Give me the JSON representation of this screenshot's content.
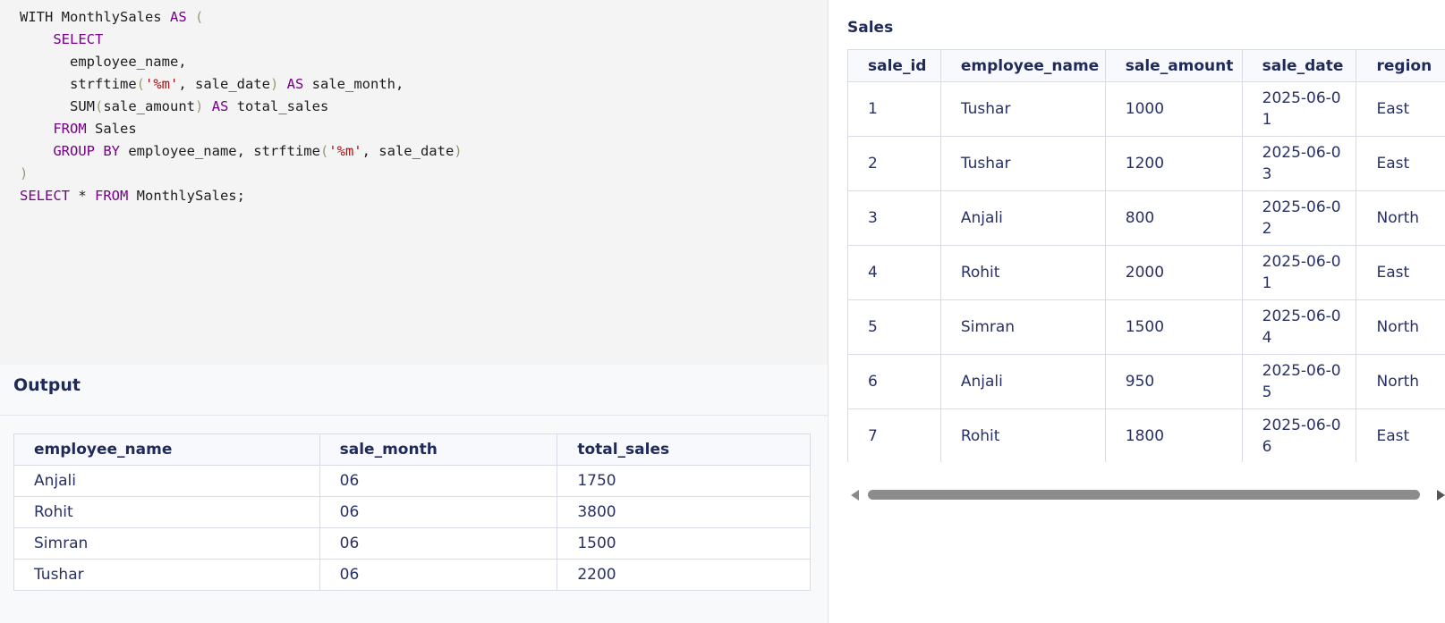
{
  "editor": {
    "lines": [
      [
        {
          "t": "WITH MonthlySales ",
          "c": ""
        },
        {
          "t": "AS",
          "c": "kw"
        },
        {
          "t": " ",
          "c": ""
        },
        {
          "t": "(",
          "c": "pn"
        }
      ],
      [
        {
          "t": "    ",
          "c": ""
        },
        {
          "t": "SELECT",
          "c": "kw"
        }
      ],
      [
        {
          "t": "      employee_name,",
          "c": ""
        }
      ],
      [
        {
          "t": "      strftime",
          "c": ""
        },
        {
          "t": "(",
          "c": "pn"
        },
        {
          "t": "'%m'",
          "c": "str"
        },
        {
          "t": ", sale_date",
          "c": ""
        },
        {
          "t": ")",
          "c": "pn"
        },
        {
          "t": " ",
          "c": ""
        },
        {
          "t": "AS",
          "c": "kw"
        },
        {
          "t": " sale_month,",
          "c": ""
        }
      ],
      [
        {
          "t": "      SUM",
          "c": ""
        },
        {
          "t": "(",
          "c": "pn"
        },
        {
          "t": "sale_amount",
          "c": ""
        },
        {
          "t": ")",
          "c": "pn"
        },
        {
          "t": " ",
          "c": ""
        },
        {
          "t": "AS",
          "c": "kw"
        },
        {
          "t": " total_sales",
          "c": ""
        }
      ],
      [
        {
          "t": "    ",
          "c": ""
        },
        {
          "t": "FROM",
          "c": "kw"
        },
        {
          "t": " Sales",
          "c": ""
        }
      ],
      [
        {
          "t": "    ",
          "c": ""
        },
        {
          "t": "GROUP BY",
          "c": "kw"
        },
        {
          "t": " employee_name, strftime",
          "c": ""
        },
        {
          "t": "(",
          "c": "pn"
        },
        {
          "t": "'%m'",
          "c": "str"
        },
        {
          "t": ", sale_date",
          "c": ""
        },
        {
          "t": ")",
          "c": "pn"
        }
      ],
      [
        {
          "t": ")",
          "c": "pn"
        }
      ],
      [
        {
          "t": "SELECT",
          "c": "kw"
        },
        {
          "t": " * ",
          "c": ""
        },
        {
          "t": "FROM",
          "c": "kw"
        },
        {
          "t": " MonthlySales;",
          "c": ""
        }
      ]
    ]
  },
  "output": {
    "title": "Output",
    "columns": [
      "employee_name",
      "sale_month",
      "total_sales"
    ],
    "rows": [
      [
        "Anjali",
        "06",
        "1750"
      ],
      [
        "Rohit",
        "06",
        "3800"
      ],
      [
        "Simran",
        "06",
        "1500"
      ],
      [
        "Tushar",
        "06",
        "2200"
      ]
    ]
  },
  "sales": {
    "title": "Sales",
    "columns": [
      "sale_id",
      "employee_name",
      "sale_amount",
      "sale_date",
      "region"
    ],
    "rows": [
      [
        "1",
        "Tushar",
        "1000",
        "2025-06-01",
        "East"
      ],
      [
        "2",
        "Tushar",
        "1200",
        "2025-06-03",
        "East"
      ],
      [
        "3",
        "Anjali",
        "800",
        "2025-06-02",
        "North"
      ],
      [
        "4",
        "Rohit",
        "2000",
        "2025-06-01",
        "East"
      ],
      [
        "5",
        "Simran",
        "1500",
        "2025-06-04",
        "North"
      ],
      [
        "6",
        "Anjali",
        "950",
        "2025-06-05",
        "North"
      ],
      [
        "7",
        "Rohit",
        "1800",
        "2025-06-06",
        "East"
      ]
    ]
  },
  "icons": {
    "scroll_left": "scroll-left-arrow-icon",
    "scroll_right": "scroll-right-arrow-icon"
  },
  "colors": {
    "keyword": "#770088",
    "string": "#aa1111",
    "text": "#273167",
    "editor_bg": "#f4f4f4"
  }
}
